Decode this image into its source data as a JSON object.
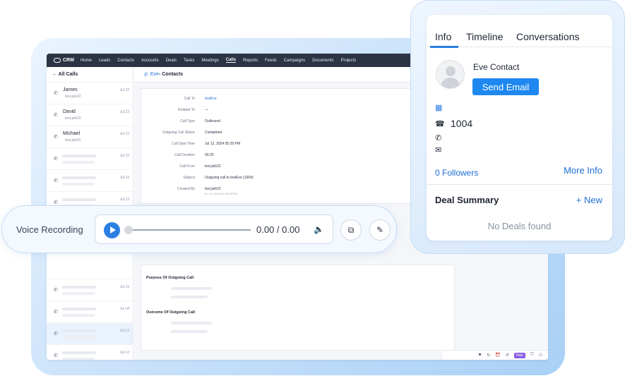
{
  "nav": {
    "brand": "CRM",
    "items": [
      "Home",
      "Leads",
      "Contacts",
      "Accounts",
      "Deals",
      "Tasks",
      "Meetings",
      "Calls",
      "Reports",
      "Feeds",
      "Campaigns",
      "Documents",
      "Projects"
    ],
    "active": "Calls"
  },
  "sidebar": {
    "back_label": "← All Calls",
    "calls": [
      {
        "name": "James",
        "sub": "test.jwb22",
        "date": "Jul 23"
      },
      {
        "name": "David",
        "sub": "test.jwb22",
        "date": "Jul 23"
      },
      {
        "name": "Michael",
        "sub": "test.jwb22",
        "date": "Jul 23"
      },
      {
        "date": "Jul 23"
      },
      {
        "date": "Jul 23"
      },
      {
        "date": "Jul 23"
      },
      {
        "date": "Jul 19"
      },
      {
        "date": "Jul 18"
      },
      {
        "date": "Jul 12"
      },
      {
        "date": "Jul 12"
      }
    ]
  },
  "main": {
    "header_link": "Eve",
    "header_rest": " - Contacts",
    "details": [
      {
        "label": "Call To",
        "value": "testEve"
      },
      {
        "label": "Related To",
        "value": "—"
      },
      {
        "label": "Call Type",
        "value": "Outbound"
      },
      {
        "label": "Outgoing Call Status",
        "value": "Completed"
      },
      {
        "label": "Call Start Time",
        "value": "Jul 12, 2024 05:29 PM"
      },
      {
        "label": "Call Duration",
        "value": "00:25"
      },
      {
        "label": "Call From",
        "value": "test.jwb22"
      },
      {
        "label": "Subject",
        "value": "Outgoing call to testEve (1004)"
      },
      {
        "label": "Created By",
        "value": "test.jwb22",
        "value2": "Fri, 12 Jul 2024 05:30 PM"
      }
    ],
    "purpose_title": "Purpose Of Outgoing Call",
    "outcome_title": "Outcome Of Outgoing Call"
  },
  "statusbar": {
    "badge": "Help"
  },
  "voice": {
    "label": "Voice Recording",
    "time": "0.00 / 0.00",
    "progress": 0
  },
  "info_panel": {
    "tabs": [
      "Info",
      "Timeline",
      "Conversations"
    ],
    "active_tab": "Info",
    "contact_name": "Eve Contact",
    "send_email": "Send Email",
    "phone": "1004",
    "followers": "0 Followers",
    "more_info": "More Info",
    "deal_summary": "Deal Summary",
    "new_label": "+ New",
    "no_deals": "No Deals found"
  },
  "colors": {
    "accent": "#1e88f0",
    "nav_bg": "#2b3344",
    "link": "#1f6fd6"
  },
  "icons": [
    "phone-call-icon",
    "play-icon",
    "volume-icon",
    "copy-icon",
    "edit-icon",
    "building-icon",
    "telephone-icon",
    "mobile-icon",
    "mail-icon"
  ]
}
